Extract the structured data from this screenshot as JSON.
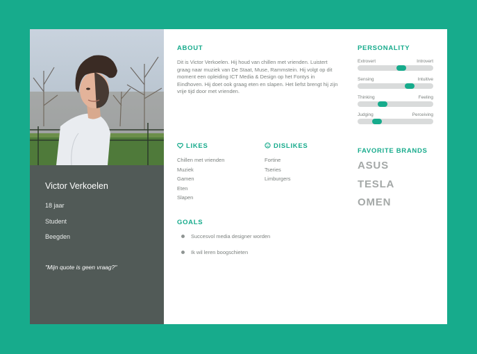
{
  "person": {
    "name": "Victor Verkoelen",
    "age": "18 jaar",
    "occupation": "Student",
    "location": "Beegden",
    "quote": "\"Mijn quote is geen vraag?\""
  },
  "about": {
    "title": "ABOUT",
    "text": "Dit is Victor Verkoelen. Hij houd van chillen met vrienden. Luistert graag naar muziek van De Staat, Muse, Rammstein. Hij volgt op dit moment een opleiding ICT Media & Design op het Fontys in Eindhoven. Hij doet ook graag eten en slapen. Het liefst brengt hij zijn vrije tijd door met vrienden."
  },
  "likes": {
    "title": "LIKES",
    "icon": "heart-icon",
    "items": [
      "Chillen met vrienden",
      "Muziek",
      "Gamen",
      "Eten",
      "Slapen"
    ]
  },
  "dislikes": {
    "title": "DISLIKES",
    "icon": "sad-face-icon",
    "items": [
      "Fortine",
      "Tseries",
      "Limburgers"
    ]
  },
  "goals": {
    "title": "GOALS",
    "items": [
      "Succesvol media designer worden",
      "Ik wil leren boogschieten"
    ]
  },
  "personality": {
    "title": "PERSONALITY",
    "traits": [
      {
        "left": "Extrovert",
        "right": "Introvert",
        "value": 0.58
      },
      {
        "left": "Sensing",
        "right": "Intuitive",
        "value": 0.69
      },
      {
        "left": "Thinking",
        "right": "Feeling",
        "value": 0.33
      },
      {
        "left": "Judging",
        "right": "Perceiving",
        "value": 0.26
      }
    ]
  },
  "brands": {
    "title": "FAVORITE BRANDS",
    "items": [
      "ASUS",
      "TESLA",
      "OMEN"
    ]
  },
  "colors": {
    "accent": "#17ab8c",
    "sidebar": "#515a57",
    "text": "#7b807e",
    "brand_text": "#a4a8a7"
  }
}
